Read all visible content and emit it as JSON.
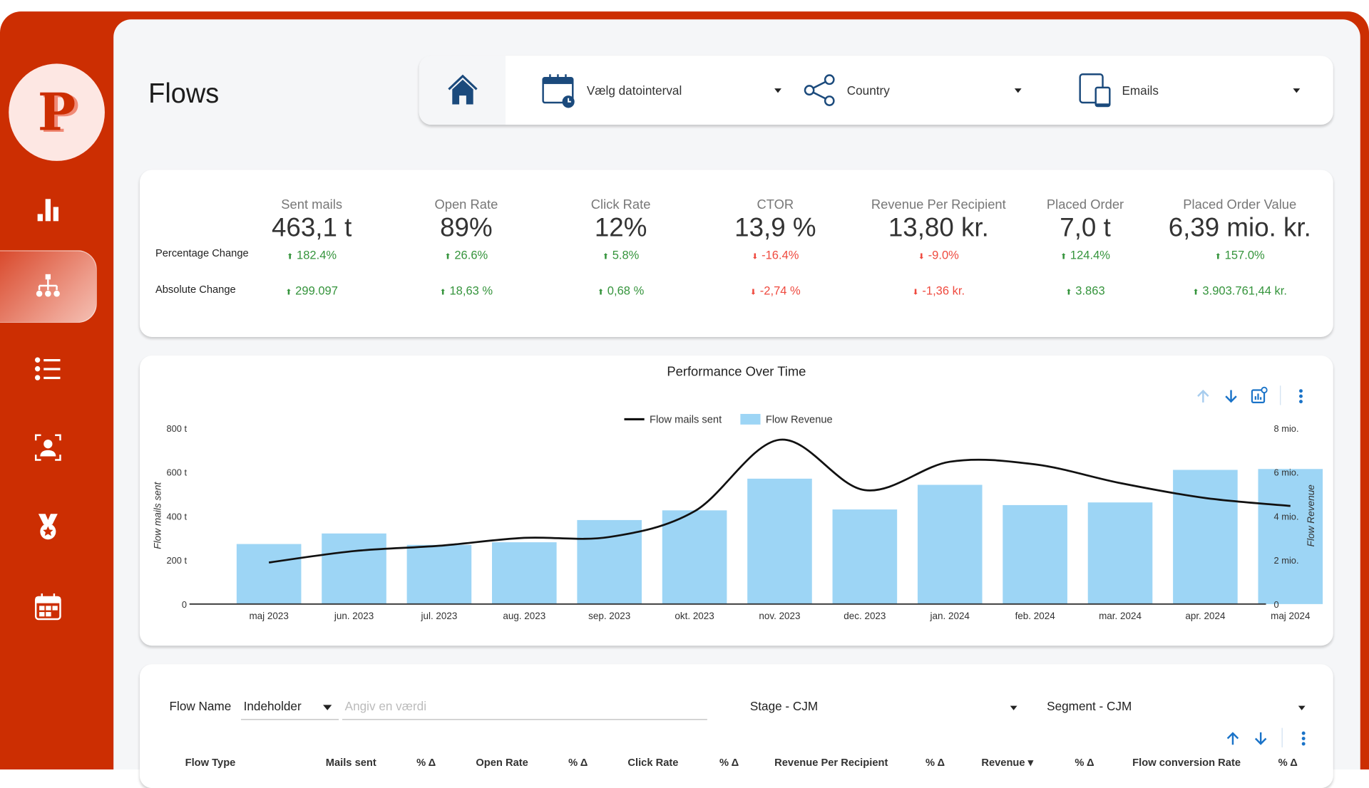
{
  "page": {
    "title": "Flows"
  },
  "colors": {
    "brand": "#cc2e02",
    "icon_navy": "#1b4a7c",
    "up": "#35943c",
    "down": "#ef4a3f",
    "bar": "#9dd5f5",
    "toolbar_blue": "#1a73c8"
  },
  "sidebar": {
    "logo_letter": "P",
    "items": [
      {
        "icon": "bar-chart-icon",
        "label": "Overview",
        "active": false
      },
      {
        "icon": "sitemap-icon",
        "label": "Flows",
        "active": true
      },
      {
        "icon": "list-icon",
        "label": "Campaigns",
        "active": false
      },
      {
        "icon": "person-focus-icon",
        "label": "Profiles",
        "active": false
      },
      {
        "icon": "medal-icon",
        "label": "Benchmarks",
        "active": false
      },
      {
        "icon": "calendar-icon",
        "label": "Calendar",
        "active": false
      }
    ]
  },
  "filters": {
    "home_icon": "home-icon",
    "date": {
      "icon": "calendar-clock-icon",
      "label": "Vælg datointerval"
    },
    "country": {
      "icon": "share-icon",
      "label": "Country"
    },
    "channel": {
      "icon": "devices-icon",
      "label": "Emails"
    }
  },
  "kpis": {
    "row_labels": {
      "percentage": "Percentage Change",
      "absolute": "Absolute Change"
    },
    "items": [
      {
        "title": "Sent mails",
        "value": "463,1 t",
        "pct": "182.4%",
        "abs": "299.097",
        "trend": "up"
      },
      {
        "title": "Open Rate",
        "value": "89%",
        "pct": "26.6%",
        "abs": "18,63 %",
        "trend": "up"
      },
      {
        "title": "Click Rate",
        "value": "12%",
        "pct": "5.8%",
        "abs": "0,68 %",
        "trend": "up"
      },
      {
        "title": "CTOR",
        "value": "13,9 %",
        "pct": "-16.4%",
        "abs": "-2,74 %",
        "trend": "down"
      },
      {
        "title": "Revenue Per Recipient",
        "value": "13,80 kr.",
        "pct": "-9.0%",
        "abs": "-1,36 kr.",
        "trend": "down"
      },
      {
        "title": "Placed Order",
        "value": "7,0 t",
        "pct": "124.4%",
        "abs": "3.863",
        "trend": "up"
      },
      {
        "title": "Placed Order Value",
        "value": "6,39 mio. kr.",
        "pct": "157.0%",
        "abs": "3.903.761,44 kr.",
        "trend": "up"
      }
    ]
  },
  "chart_toolbar": {
    "sort_asc": "arrow-up-icon",
    "sort_desc": "arrow-down-icon",
    "explore": "chart-settings-icon",
    "more": "more-vert-icon"
  },
  "chart_data": {
    "type": "bar",
    "title": "Performance Over Time",
    "categories": [
      "maj 2023",
      "jun. 2023",
      "jul. 2023",
      "aug. 2023",
      "sep. 2023",
      "okt. 2023",
      "nov. 2023",
      "dec. 2023",
      "jan. 2024",
      "feb. 2024",
      "mar. 2024",
      "apr. 2024",
      "maj 2024"
    ],
    "series": [
      {
        "name": "Flow Revenue",
        "type": "bar",
        "axis": "right",
        "unit": "mio.",
        "values": [
          2.73,
          3.21,
          2.69,
          2.81,
          3.82,
          4.26,
          5.7,
          4.3,
          5.42,
          4.5,
          4.62,
          6.1,
          6.14
        ]
      },
      {
        "name": "Flow mails sent",
        "type": "line",
        "axis": "left",
        "unit": "t",
        "values": [
          189,
          241,
          265,
          301,
          305,
          422,
          747,
          518,
          647,
          635,
          550,
          482,
          446
        ]
      }
    ],
    "legend": {
      "position": "top-center",
      "entries": [
        "Flow mails sent",
        "Flow Revenue"
      ]
    },
    "y_left": {
      "label": "Flow mails sent",
      "range": [
        0,
        800
      ],
      "ticks": [
        "0",
        "200 t",
        "400 t",
        "600 t",
        "800 t"
      ]
    },
    "y_right": {
      "label": "Flow Revenue",
      "range": [
        0,
        8
      ],
      "ticks": [
        "0",
        "2 mio.",
        "4 mio.",
        "6 mio.",
        "8 mio."
      ]
    },
    "grid": false
  },
  "table": {
    "filters": {
      "flow_name_label": "Flow Name",
      "operator": "Indeholder",
      "value_placeholder": "Angiv en værdi",
      "stage": "Stage - CJM",
      "segment": "Segment - CJM"
    },
    "columns": [
      "Flow Type",
      "Mails sent",
      "% Δ",
      "Open Rate",
      "% Δ",
      "Click Rate",
      "% Δ",
      "Revenue Per Recipient",
      "% Δ",
      "Revenue ▾",
      "% Δ",
      "Flow conversion Rate",
      "% Δ"
    ]
  }
}
